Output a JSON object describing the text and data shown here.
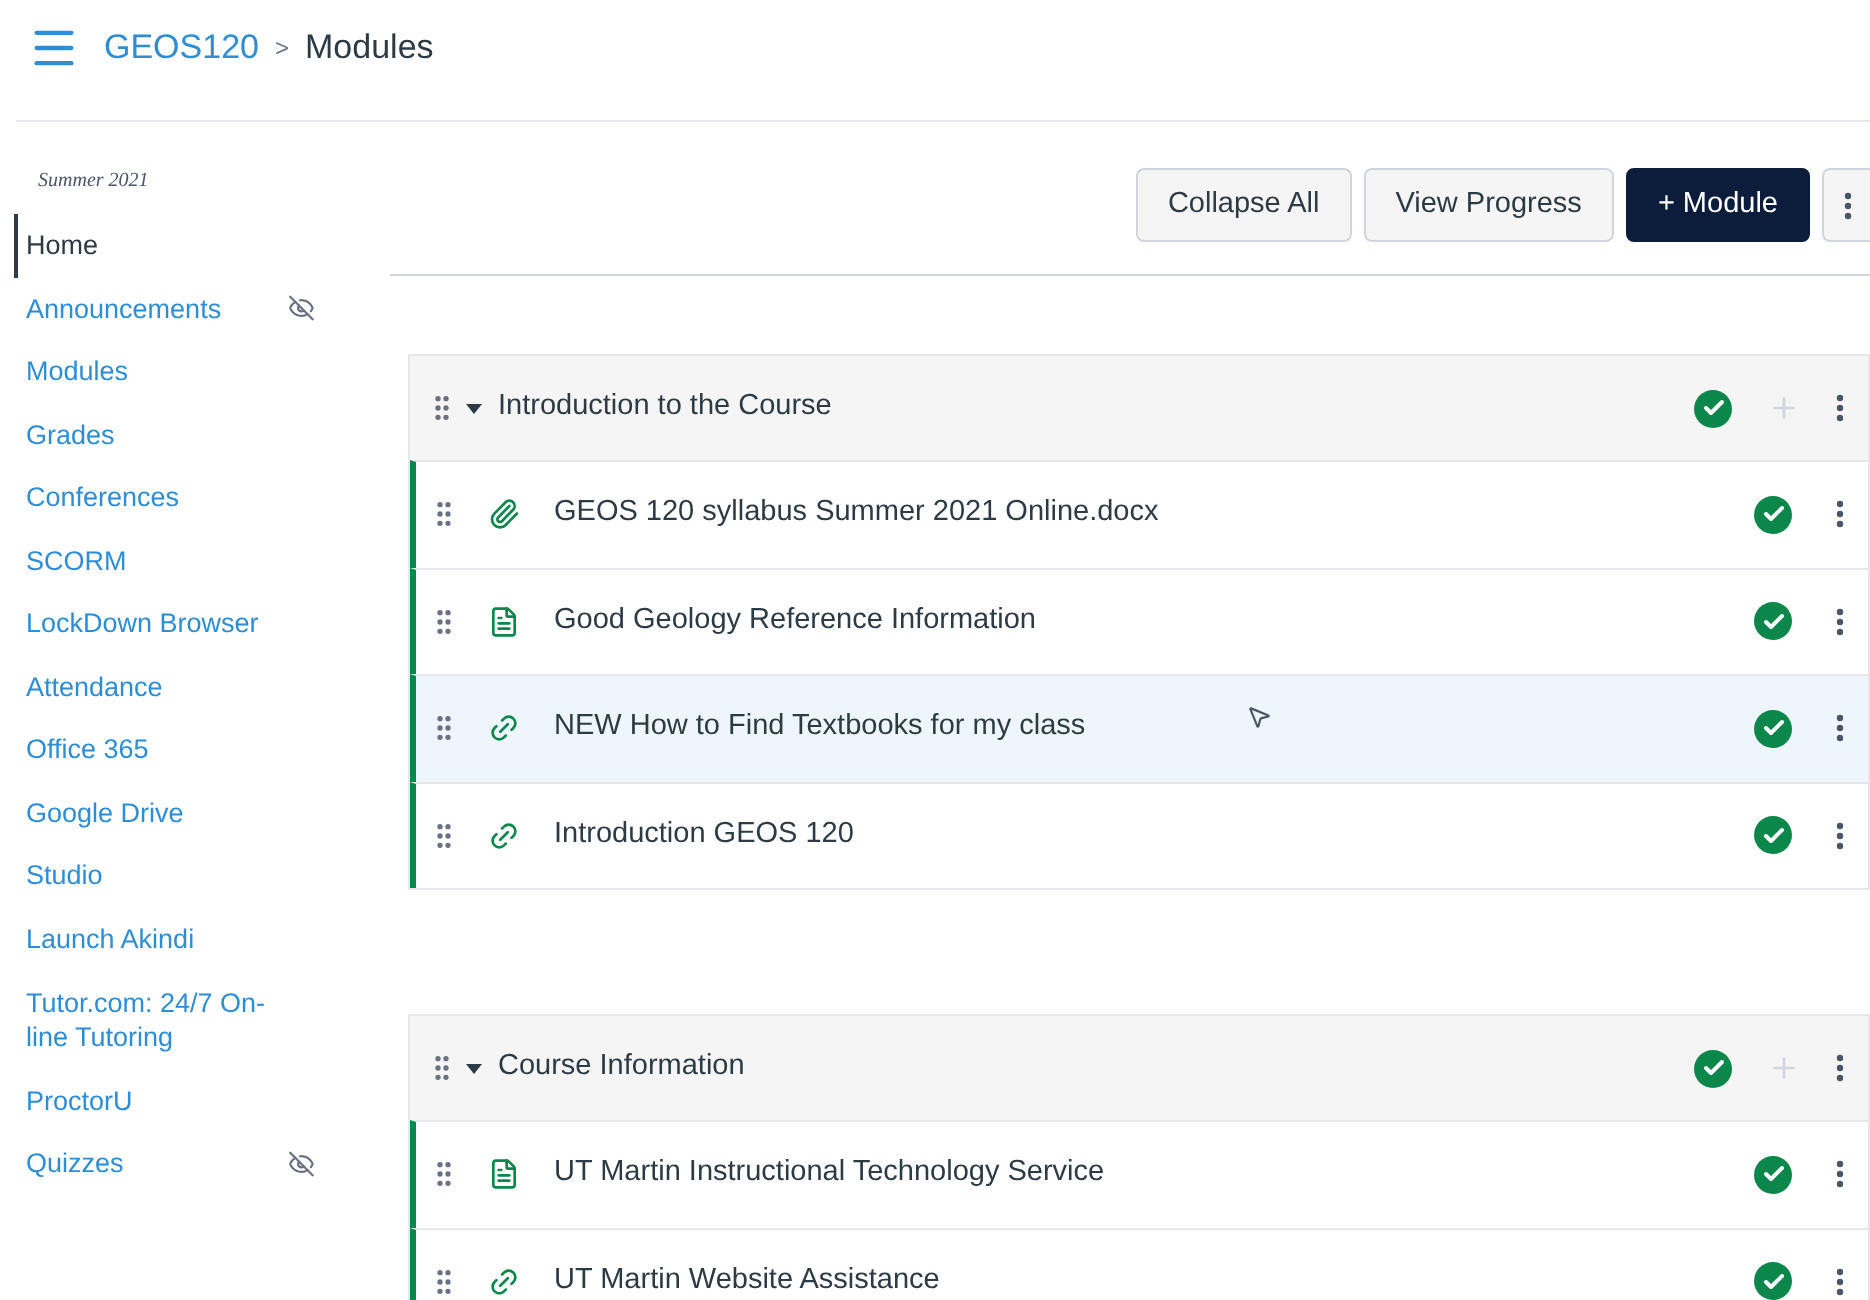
{
  "breadcrumb": {
    "course": "GEOS120",
    "separator": ">",
    "page": "Modules"
  },
  "sidebar": {
    "term": "Summer 2021",
    "items": [
      {
        "label": "Home",
        "selected": true,
        "hidden": false
      },
      {
        "label": "Announcements",
        "selected": false,
        "hidden": true
      },
      {
        "label": "Modules",
        "selected": false,
        "hidden": false
      },
      {
        "label": "Grades",
        "selected": false,
        "hidden": false
      },
      {
        "label": "Conferences",
        "selected": false,
        "hidden": false
      },
      {
        "label": "SCORM",
        "selected": false,
        "hidden": false
      },
      {
        "label": "LockDown Browser",
        "selected": false,
        "hidden": false
      },
      {
        "label": "Attendance",
        "selected": false,
        "hidden": false
      },
      {
        "label": "Office 365",
        "selected": false,
        "hidden": false
      },
      {
        "label": "Google Drive",
        "selected": false,
        "hidden": false
      },
      {
        "label": "Studio",
        "selected": false,
        "hidden": false
      },
      {
        "label": "Launch Akindi",
        "selected": false,
        "hidden": false
      },
      {
        "label": "Tutor.com: 24/7 On-line Tutoring",
        "selected": false,
        "hidden": false
      },
      {
        "label": "ProctorU",
        "selected": false,
        "hidden": false
      },
      {
        "label": "Quizzes",
        "selected": false,
        "hidden": true
      }
    ]
  },
  "toolbar": {
    "buttons": [
      {
        "label": "Collapse All",
        "kind": "secondary"
      },
      {
        "label": "View Progress",
        "kind": "secondary"
      },
      {
        "label": "+ Module",
        "kind": "primary"
      }
    ]
  },
  "modules": [
    {
      "title": "Introduction to the Course",
      "expanded": true,
      "published": true,
      "items": [
        {
          "title": "GEOS 120 syllabus Summer 2021 Online.docx",
          "kind": "attachment",
          "published": true,
          "hovered": false
        },
        {
          "title": "Good Geology Reference Information",
          "kind": "page",
          "published": true,
          "hovered": false
        },
        {
          "title": "NEW How to Find Textbooks for my class",
          "kind": "link",
          "published": true,
          "hovered": true
        },
        {
          "title": "Introduction GEOS 120",
          "kind": "link",
          "published": true,
          "hovered": false
        }
      ]
    },
    {
      "title": "Course Information",
      "expanded": true,
      "published": true,
      "items": [
        {
          "title": "UT Martin Instructional Technology Service",
          "kind": "page",
          "published": true,
          "hovered": false
        },
        {
          "title": "UT Martin Website Assistance",
          "kind": "link",
          "published": true,
          "hovered": false
        }
      ]
    }
  ]
}
